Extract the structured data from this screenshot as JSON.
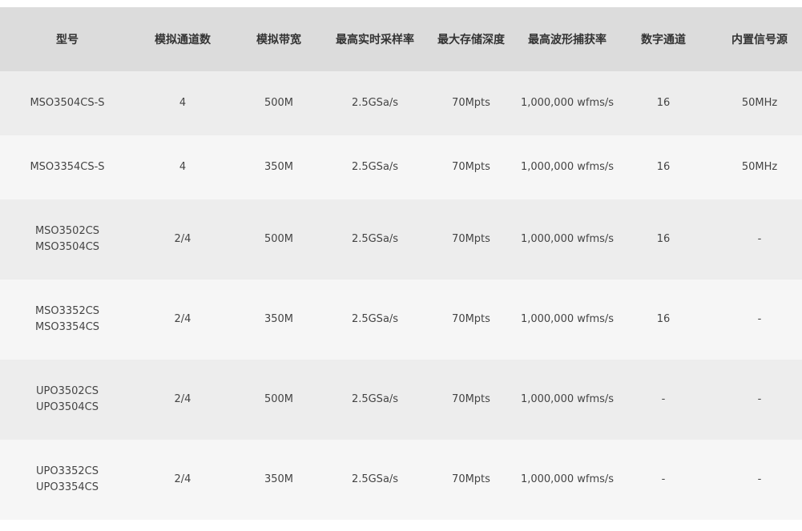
{
  "columns": [
    "型号",
    "模拟通道数",
    "模拟带宽",
    "最高实时采样率",
    "最大存储深度",
    "最高波形捕获率",
    "数字通道",
    "内置信号源"
  ],
  "rows": [
    {
      "model": [
        "MSO3504CS-S"
      ],
      "analog_channels": "4",
      "bandwidth": "500M",
      "sample_rate": "2.5GSa/s",
      "memory_depth": "70Mpts",
      "capture_rate": "1,000,000 wfms/s",
      "digital_channels": "16",
      "signal_source": "50MHz"
    },
    {
      "model": [
        "MSO3354CS-S"
      ],
      "analog_channels": "4",
      "bandwidth": "350M",
      "sample_rate": "2.5GSa/s",
      "memory_depth": "70Mpts",
      "capture_rate": "1,000,000 wfms/s",
      "digital_channels": "16",
      "signal_source": "50MHz"
    },
    {
      "model": [
        "MSO3502CS",
        "MSO3504CS"
      ],
      "analog_channels": "2/4",
      "bandwidth": "500M",
      "sample_rate": "2.5GSa/s",
      "memory_depth": "70Mpts",
      "capture_rate": "1,000,000 wfms/s",
      "digital_channels": "16",
      "signal_source": "-"
    },
    {
      "model": [
        "MSO3352CS",
        "MSO3354CS"
      ],
      "analog_channels": "2/4",
      "bandwidth": "350M",
      "sample_rate": "2.5GSa/s",
      "memory_depth": "70Mpts",
      "capture_rate": "1,000,000 wfms/s",
      "digital_channels": "16",
      "signal_source": "-"
    },
    {
      "model": [
        "UPO3502CS",
        "UPO3504CS"
      ],
      "analog_channels": "2/4",
      "bandwidth": "500M",
      "sample_rate": "2.5GSa/s",
      "memory_depth": "70Mpts",
      "capture_rate": "1,000,000 wfms/s",
      "digital_channels": "-",
      "signal_source": "-"
    },
    {
      "model": [
        "UPO3352CS",
        "UPO3354CS"
      ],
      "analog_channels": "2/4",
      "bandwidth": "350M",
      "sample_rate": "2.5GSa/s",
      "memory_depth": "70Mpts",
      "capture_rate": "1,000,000 wfms/s",
      "digital_channels": "-",
      "signal_source": "-"
    }
  ],
  "icons": {
    "overflow": "chevron-down-icon"
  }
}
